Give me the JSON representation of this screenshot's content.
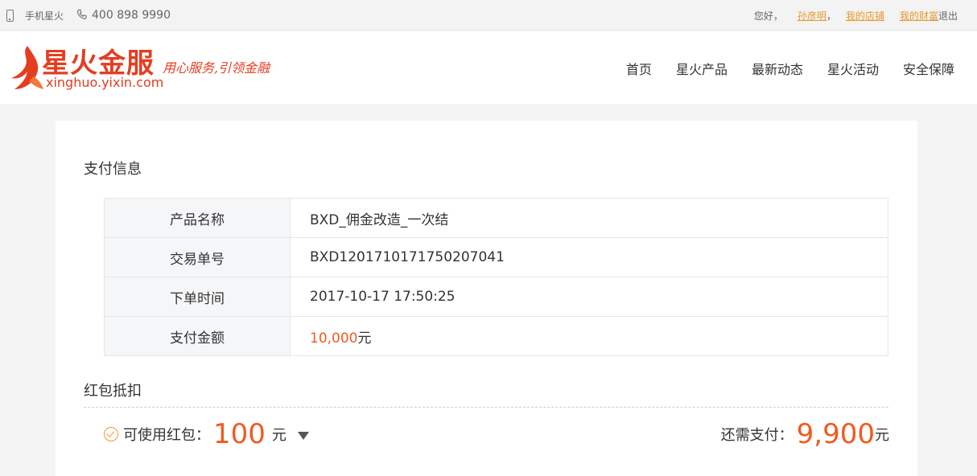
{
  "topbar": {
    "mobile_label": "手机星火",
    "hotline": "400 898 9990",
    "greeting": "您好，",
    "username": "孙彦明",
    "comma": "，",
    "my_shop": "我的店铺",
    "my_wealth": "我的财富",
    "logout": "退出"
  },
  "header": {
    "brand": "星火金服",
    "slogan": "用心服务,引领金融",
    "domain": "xinghuo.yixin.com",
    "nav": [
      "首页",
      "星火产品",
      "最新动态",
      "星火活动",
      "安全保障"
    ]
  },
  "payment_info": {
    "title": "支付信息",
    "rows": [
      {
        "label": "产品名称",
        "value": "BXD_佣金改造_一次结"
      },
      {
        "label": "交易单号",
        "value": "BXD1201710171750207041"
      },
      {
        "label": "下单时间",
        "value": "2017-10-17 17:50:25"
      },
      {
        "label": "支付金额",
        "amount": "10,000",
        "unit": "元"
      }
    ]
  },
  "red_packet": {
    "title": "红包抵扣",
    "available_label": "可使用红包：",
    "available_value": "100",
    "available_unit": "元",
    "due_label": "还需支付：",
    "due_value": "9,900",
    "due_unit": "元"
  },
  "colors": {
    "accent": "#f05a1e",
    "brand_red": "#e43d20",
    "link": "#e8982a"
  }
}
